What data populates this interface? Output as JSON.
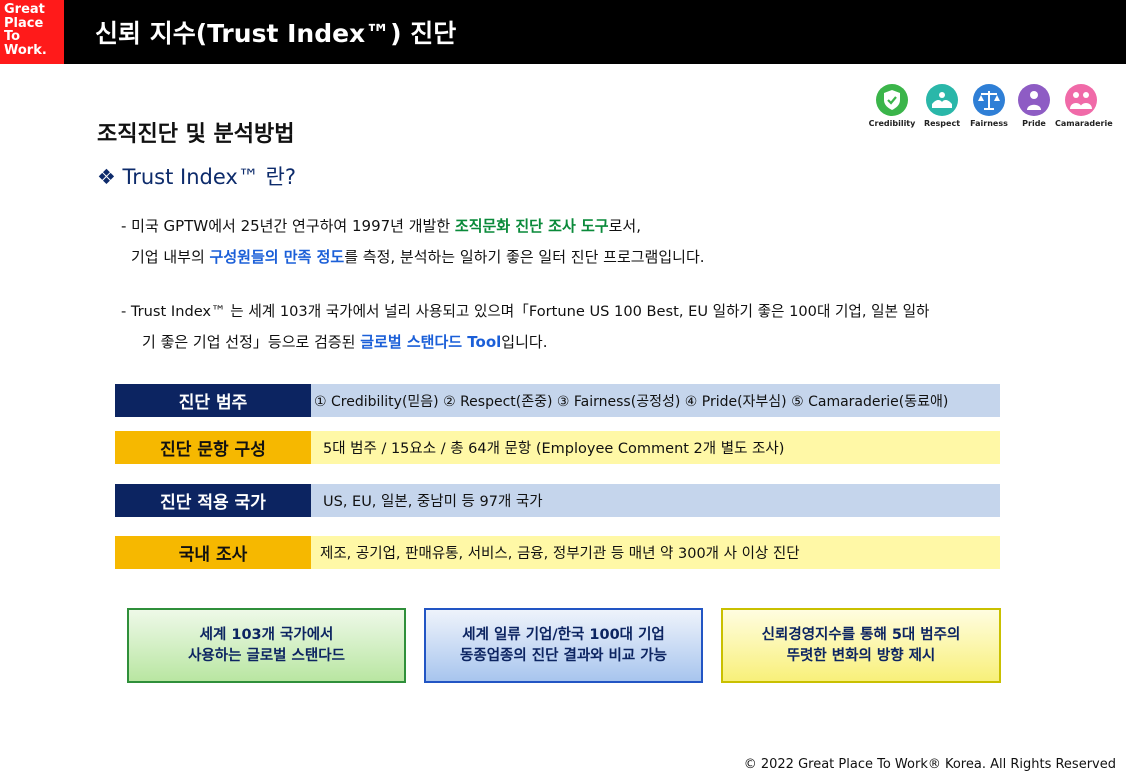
{
  "header": {
    "logo_lines": [
      "Great",
      "Place",
      "To",
      "Work."
    ],
    "title": "신뢰 지수(Trust Index™) 진단"
  },
  "icons": [
    {
      "name": "credibility-icon",
      "label": "Credibility",
      "color": "#3bb54a"
    },
    {
      "name": "respect-icon",
      "label": "Respect",
      "color": "#2ab7a9"
    },
    {
      "name": "fairness-icon",
      "label": "Fairness",
      "color": "#2f7fd6"
    },
    {
      "name": "pride-icon",
      "label": "Pride",
      "color": "#8e5cc4"
    },
    {
      "name": "camaraderie-icon",
      "label": "Camaraderie",
      "color": "#f06aa8"
    }
  ],
  "section_title": "조직진단 및 분석방법",
  "sub_title": "❖ Trust Index™ 란?",
  "para1": {
    "l1a": "- 미국 GPTW에서 25년간 연구하여 1997년 개발한 ",
    "l1b": "조직문화 진단 조사 도구",
    "l1c": "로서,",
    "l2a": "기업 내부의 ",
    "l2b": "구성원들의 만족 정도",
    "l2c": "를 측정, 분석하는 일하기 좋은 일터 진단 프로그램입니다."
  },
  "para2": {
    "l1": "-   Trust Index™ 는 세계 103개 국가에서 널리 사용되고 있으며「Fortune US 100 Best, EU 일하기 좋은 100대 기업, 일본 일하",
    "l2a": "기 좋은 기업 선정」등으로 검증된 ",
    "l2b": "글로벌 스탠다드 Tool",
    "l2c": "입니다."
  },
  "rows": [
    {
      "label": "진단 범주",
      "value": "① Credibility(믿음) ② Respect(존중) ③ Fairness(공정성) ④ Pride(자부심) ⑤ Camaraderie(동료애)"
    },
    {
      "label": "진단 문항 구성",
      "value": "5대 범주 / 15요소 /  총 64개 문항 (Employee Comment 2개 별도 조사)"
    },
    {
      "label": "진단 적용 국가",
      "value": "US, EU, 일본, 중남미 등 97개 국가"
    },
    {
      "label": "국내 조사",
      "value": "제조, 공기업, 판매유통, 서비스, 금융, 정부기관 등 매년 약 300개 사 이상 진단"
    }
  ],
  "boxes": [
    {
      "line1": "세계 103개 국가에서",
      "line2": "사용하는 글로벌 스탠다드"
    },
    {
      "line1": "세계 일류 기업/한국 100대 기업",
      "line2": "동종업종의 진단 결과와 비교 가능"
    },
    {
      "line1": "신뢰경영지수를 통해 5대 범주의",
      "line2": "뚜렷한 변화의 방향 제시"
    }
  ],
  "footer": "© 2022 Great Place To Work® Korea. All Rights Reserved"
}
